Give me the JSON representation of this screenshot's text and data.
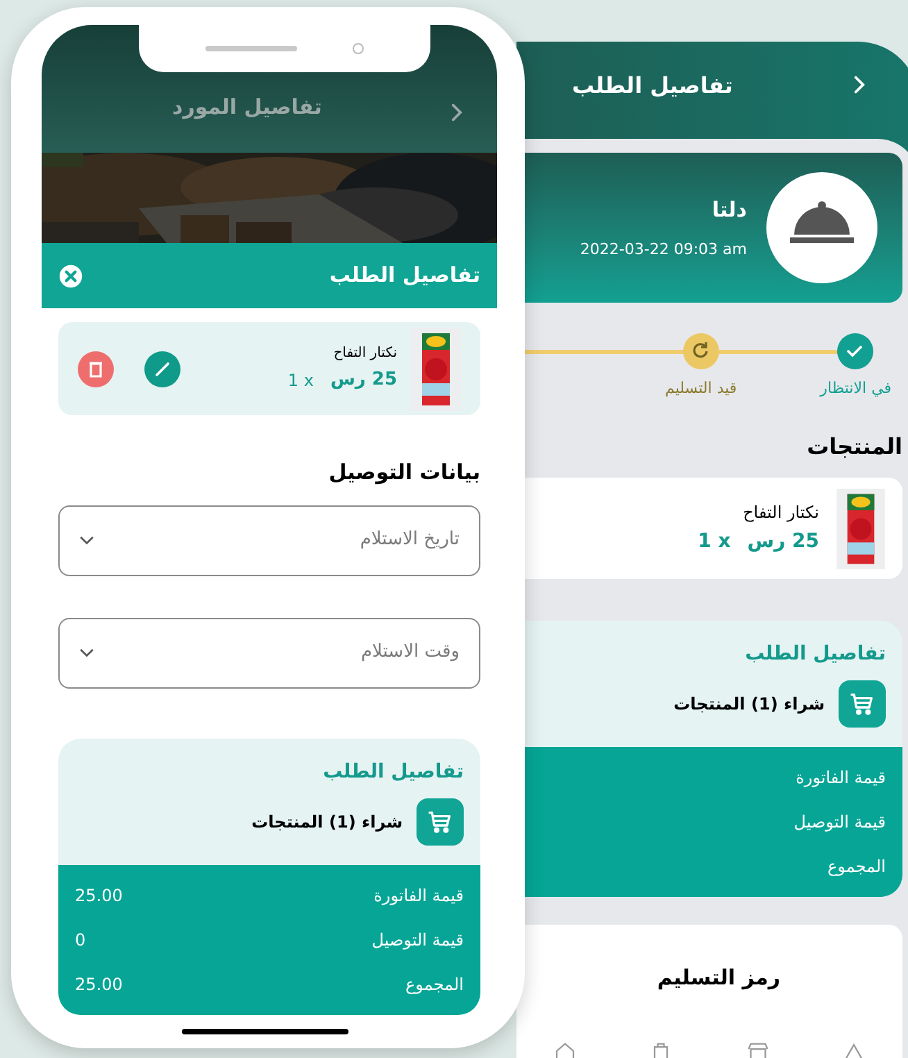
{
  "supplier_screen": {
    "title": "تفاصيل المورد"
  },
  "order_sheet": {
    "title": "تفاصيل الطلب",
    "product": {
      "name": "نكتار التفاح",
      "price": "25 رس",
      "quantity": "1 x"
    },
    "delivery_heading": "بيانات التوصيل",
    "fields": [
      {
        "placeholder": "تاريخ الاستلام"
      },
      {
        "placeholder": "وقت الاستلام"
      }
    ],
    "summary": {
      "title": "تفاصيل الطلب",
      "purchase": "شراء (1) المنتجات",
      "rows": [
        {
          "label": "قيمة الفاتورة",
          "value": "25.00"
        },
        {
          "label": "قيمة التوصيل",
          "value": "0"
        },
        {
          "label": "المجموع",
          "value": "25.00"
        }
      ]
    }
  },
  "order_screen": {
    "title": "تفاصيل الطلب",
    "store": {
      "name": "دلتا",
      "date": "2022-03-22 09:03 am"
    },
    "steps": [
      {
        "label": "في الانتظار",
        "completed": true
      },
      {
        "label": "قيد التسليم",
        "completed": false
      }
    ],
    "products_heading": "المنتجات",
    "product": {
      "name": "نكتار التفاح",
      "price": "25 رس",
      "quantity": "1 x"
    },
    "summary": {
      "title": "تفاصيل الطلب",
      "purchase": "شراء (1) المنتجات",
      "rows": [
        {
          "label": "قيمة الفاتورة"
        },
        {
          "label": "قيمة التوصيل"
        },
        {
          "label": "المجموع"
        }
      ]
    },
    "delivery_code_heading": "رمز التسليم"
  }
}
